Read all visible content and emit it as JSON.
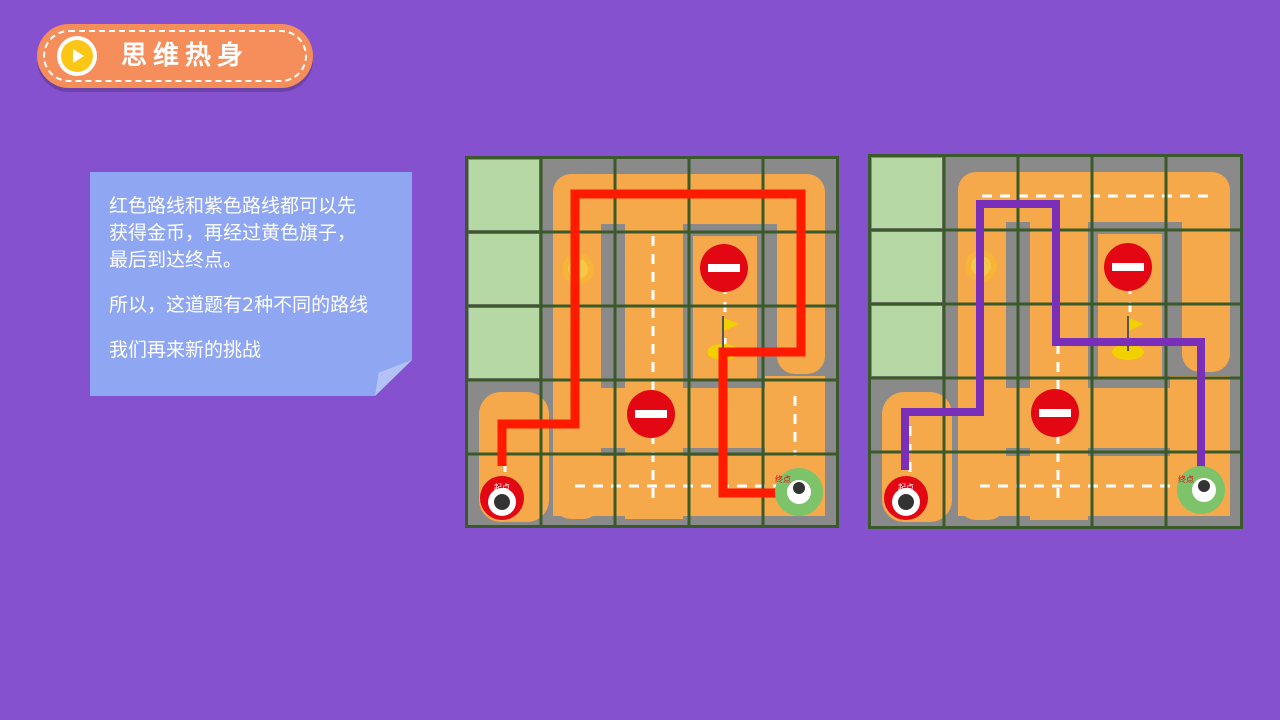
{
  "header": {
    "title": "思维热身",
    "icon": "play-icon"
  },
  "note": {
    "line1": "红色路线和紫色路线都可以先",
    "line2": "获得金币，再经过黄色旗子，",
    "line3": "最后到达终点。",
    "line4": "所以，这道题有2种不同的路线",
    "line5": "我们再来新的挑战"
  },
  "boards": [
    {
      "route_color": "#ff1a00",
      "route_name": "red-route",
      "start_label": "起点",
      "end_label": "终点"
    },
    {
      "route_color": "#7a2fb8",
      "route_name": "purple-route",
      "start_label": "起点",
      "end_label": "终点"
    }
  ],
  "colors": {
    "background": "#8551cf",
    "pill": "#f58e5a",
    "note": "#8fa6f2",
    "road": "#f5a94a",
    "grass": "#b6d8a5",
    "frame": "#3a5a2a",
    "stop": "#e30613"
  }
}
